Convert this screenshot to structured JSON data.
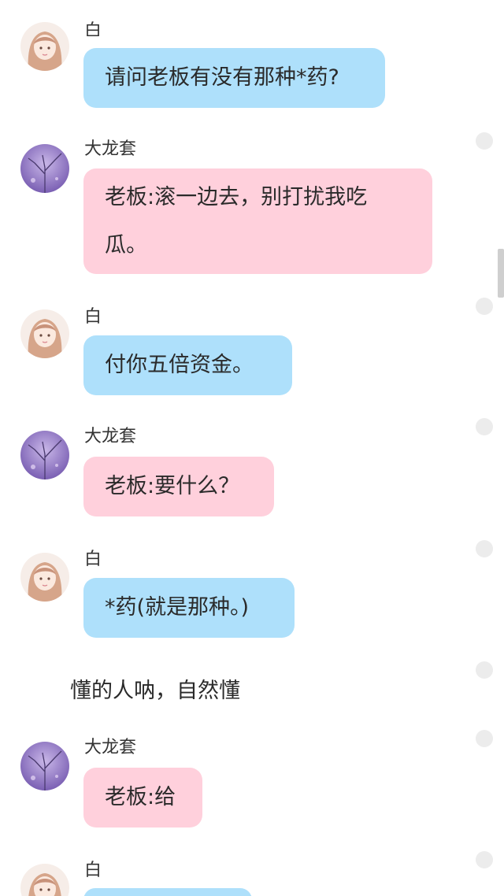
{
  "messages": [
    {
      "sender": "白",
      "text": "请问老板有没有那种*药?",
      "style": "blue"
    },
    {
      "sender": "大龙套",
      "lines": [
        "老板:滚一边去，别打扰我吃",
        "瓜。"
      ],
      "style": "pink"
    },
    {
      "sender": "白",
      "text": "付你五倍资金。",
      "style": "blue"
    },
    {
      "sender": "大龙套",
      "text": "老板:要什么？",
      "style": "pink"
    },
    {
      "sender": "白",
      "text": "*药(就是那种。)",
      "style": "blue"
    },
    {
      "narration": "懂的人呐，自然懂"
    },
    {
      "sender": "大龙套",
      "text": "老板:给",
      "style": "pink"
    },
    {
      "sender": "白",
      "text": "",
      "style": "blue"
    }
  ],
  "avatars": {
    "bai": {
      "icon": "girl-avatar-icon",
      "colors": {
        "hair": "#d6a58a",
        "skin": "#fbe9df",
        "bg": "#f6ede8"
      }
    },
    "dalongtao": {
      "icon": "purple-tree-avatar-icon",
      "colors": {
        "sky": "#7a5fb3",
        "light": "#c9b7e8",
        "branches": "#4a3a6e"
      }
    }
  },
  "colors": {
    "bubble_blue": "#aee0fb",
    "bubble_pink": "#ffd0dc",
    "select_dot": "#ececec"
  }
}
